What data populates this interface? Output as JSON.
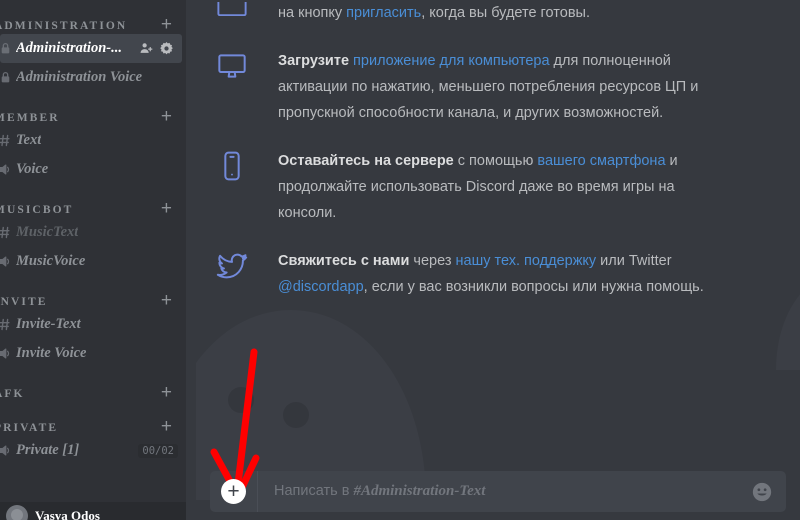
{
  "app": {
    "name": "Discord",
    "theme_bg_main": "#36393f",
    "theme_bg_sidebar": "#2f3136",
    "accent_link": "#4a8ed6",
    "annotation_color": "#ff0000"
  },
  "sidebar": {
    "categories": [
      {
        "label": "ADMINISTRATION",
        "add_label": "+",
        "channels": [
          {
            "name": "Administration-...",
            "type": "text",
            "glyph": "lock",
            "state": "selected",
            "icons": [
              "person-add-icon",
              "gear-icon"
            ]
          },
          {
            "name": "Administration Voice",
            "type": "voice",
            "glyph": "lock-voice",
            "state": "normal"
          }
        ]
      },
      {
        "label": "MEMBER",
        "add_label": "+",
        "channels": [
          {
            "name": "Text",
            "type": "text",
            "glyph": "hash",
            "state": "normal"
          },
          {
            "name": "Voice",
            "type": "voice",
            "glyph": "speaker",
            "state": "normal"
          }
        ]
      },
      {
        "label": "MUSICBOT",
        "add_label": "+",
        "channels": [
          {
            "name": "MusicText",
            "type": "text",
            "glyph": "hash",
            "state": "dim"
          },
          {
            "name": "MusicVoice",
            "type": "voice",
            "glyph": "speaker",
            "state": "normal"
          }
        ]
      },
      {
        "label": "INVITE",
        "add_label": "+",
        "channels": [
          {
            "name": "Invite-Text",
            "type": "text",
            "glyph": "hash",
            "state": "normal"
          },
          {
            "name": "Invite Voice",
            "type": "voice",
            "glyph": "speaker",
            "state": "normal"
          }
        ]
      },
      {
        "label": "AFK",
        "add_label": "+",
        "channels": []
      },
      {
        "label": "PRIVATE",
        "add_label": "+",
        "channels": [
          {
            "name": "Private [1]",
            "type": "voice",
            "glyph": "speaker",
            "state": "normal",
            "badge": "00/02"
          }
        ]
      }
    ],
    "user": {
      "name": "Vasya Odos"
    }
  },
  "main": {
    "messages": [
      {
        "icon": "monitor-icon",
        "partial": true,
        "segments": [
          {
            "text": "на кнопку ",
            "style": "plain"
          },
          {
            "text": "пригласить",
            "style": "link"
          },
          {
            "text": ", когда вы будете готовы.",
            "style": "plain"
          }
        ]
      },
      {
        "icon": "monitor-icon",
        "segments": [
          {
            "text": "Загрузите ",
            "style": "bold"
          },
          {
            "text": "приложение для компьютера",
            "style": "link"
          },
          {
            "text": " для полноценной активации по нажатию, меньшего потребления ресурсов ЦП и пропускной способности канала, и других возможностей.",
            "style": "plain"
          }
        ]
      },
      {
        "icon": "phone-icon",
        "segments": [
          {
            "text": "Оставайтесь на сервере",
            "style": "bold"
          },
          {
            "text": " с помощью ",
            "style": "plain"
          },
          {
            "text": "вашего смартфона",
            "style": "link"
          },
          {
            "text": " и продолжайте использовать Discord даже во время игры на консоли.",
            "style": "plain"
          }
        ]
      },
      {
        "icon": "twitter-icon",
        "segments": [
          {
            "text": "Свяжитесь с нами",
            "style": "bold"
          },
          {
            "text": " через ",
            "style": "plain"
          },
          {
            "text": "нашу тех. поддержку",
            "style": "link"
          },
          {
            "text": " или Twitter ",
            "style": "plain"
          },
          {
            "text": "@discordapp",
            "style": "link"
          },
          {
            "text": ", если у вас возникли вопросы или нужна помощь.",
            "style": "plain"
          }
        ]
      }
    ],
    "composer": {
      "plus_label": "+",
      "placeholder_prefix": "Написать в ",
      "placeholder_channel": "#Administration-Text",
      "emoji": "emoji-icon"
    }
  },
  "annotation": {
    "type": "arrow",
    "points_to": "composer-plus-button",
    "color": "#ff0000"
  }
}
